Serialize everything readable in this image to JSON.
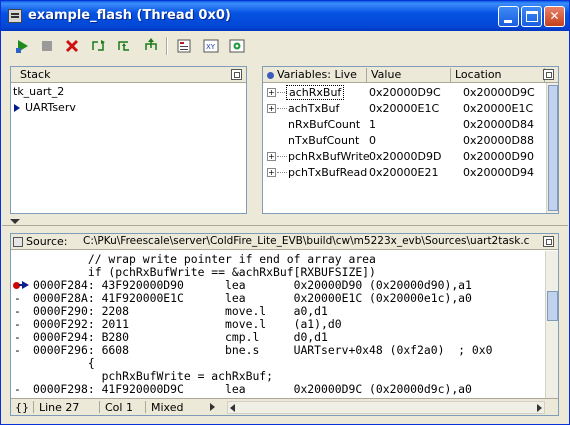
{
  "window": {
    "title": "example_flash (Thread 0x0)"
  },
  "toolbar": {
    "buttons": [
      {
        "name": "run-icon"
      },
      {
        "name": "stop-icon"
      },
      {
        "name": "kill-icon"
      },
      {
        "name": "step-over-icon"
      },
      {
        "name": "step-into-icon"
      },
      {
        "name": "step-out-icon"
      },
      {
        "name": "registers-icon"
      },
      {
        "name": "xy-icon"
      },
      {
        "name": "settings-icon"
      }
    ]
  },
  "stack": {
    "header": "Stack",
    "items": [
      "tk_uart_2",
      "UARTserv"
    ]
  },
  "variables": {
    "header": "Variables: Live",
    "columns": [
      "Value",
      "Location"
    ],
    "rows": [
      {
        "name": "achRxBuf",
        "value": "0x20000D9C",
        "location": "0x20000D9C",
        "expandable": true
      },
      {
        "name": "achTxBuf",
        "value": "0x20000E1C",
        "location": "0x20000E1C",
        "expandable": true
      },
      {
        "name": "nRxBufCount",
        "value": "1",
        "location": "0x20000D84",
        "expandable": false
      },
      {
        "name": "nTxBufCount",
        "value": "0",
        "location": "0x20000D88",
        "expandable": false
      },
      {
        "name": "pchRxBufWrite",
        "value": "0x20000D9D",
        "location": "0x20000D90",
        "expandable": true
      },
      {
        "name": "pchTxBufRead",
        "value": "0x20000E21",
        "location": "0x20000D94",
        "expandable": true
      }
    ]
  },
  "source": {
    "label": "Source:",
    "path": "C:\\PKu\\Freescale\\server\\ColdFire_Lite_EVB\\build\\cw\\m5223x_evb\\Sources\\uart2task.c",
    "lines": [
      {
        "gutter": "",
        "text": "        // wrap write pointer if end of array area"
      },
      {
        "gutter": "",
        "text": "        if (pchRxBufWrite == &achRxBuf[RXBUFSIZE])"
      },
      {
        "gutter": "bp",
        "text": "0000F284: 43F920000D90      lea       0x20000D90 (0x20000d90),a1"
      },
      {
        "gutter": "-",
        "text": "0000F28A: 41F920000E1C      lea       0x20000E1C (0x20000e1c),a0"
      },
      {
        "gutter": "-",
        "text": "0000F290: 2208              move.l    a0,d1"
      },
      {
        "gutter": "-",
        "text": "0000F292: 2011              move.l    (a1),d0"
      },
      {
        "gutter": "-",
        "text": "0000F294: B280              cmp.l     d0,d1"
      },
      {
        "gutter": "-",
        "text": "0000F296: 6608              bne.s     UARTserv+0x48 (0xf2a0)  ; 0x0"
      },
      {
        "gutter": "",
        "text": "        {"
      },
      {
        "gutter": "",
        "text": "          pchRxBufWrite = achRxBuf;"
      },
      {
        "gutter": "-",
        "text": "0000F298: 41F920000D9C      lea       0x20000D9C (0x20000d9c),a0"
      }
    ]
  },
  "status": {
    "brace": "{}",
    "line": "Line 27",
    "col": "Col 1",
    "mode": "Mixed"
  }
}
